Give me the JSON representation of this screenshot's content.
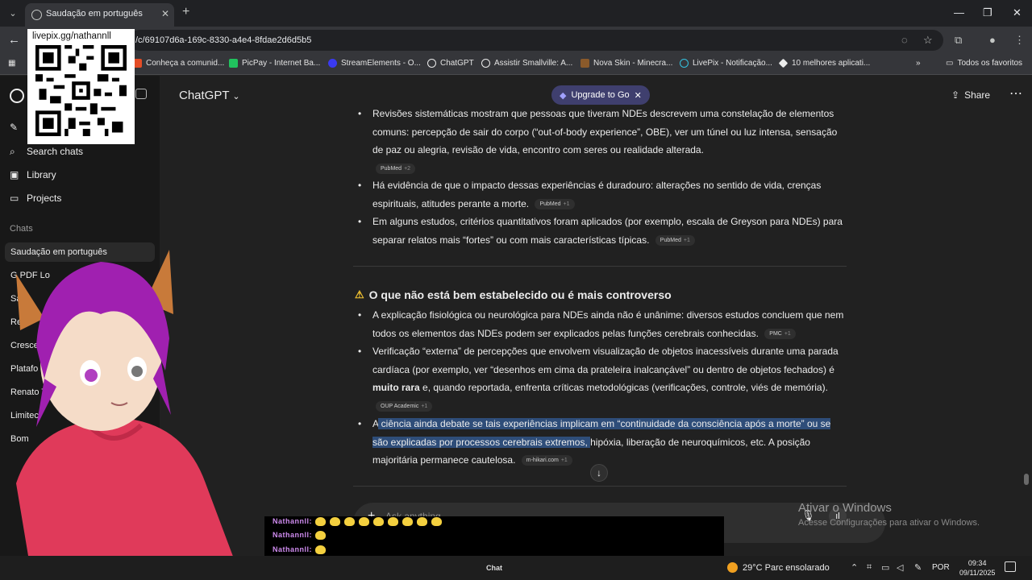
{
  "browser": {
    "tab_title": "Saudação em português",
    "url": "/c/69107d6a-169c-8330-a4e4-8fdae2d6d5b5",
    "bookmarks": [
      {
        "label": "Conheça a comunid...",
        "color": "#e44d26"
      },
      {
        "label": "PicPay - Internet Ba...",
        "color": "#21c25e"
      },
      {
        "label": "StreamElements - O...",
        "color": "#3a3af0"
      },
      {
        "label": "ChatGPT",
        "color": "#ececec"
      },
      {
        "label": "Assistir Smallville: A...",
        "color": "#ececec"
      },
      {
        "label": "Nova Skin - Minecra...",
        "color": "#8a5a2b"
      },
      {
        "label": "LivePix - Notificação...",
        "color": "#34c3e0"
      },
      {
        "label": "10 melhores aplicati...",
        "color": "#ececec"
      }
    ],
    "all_bookmarks": "Todos os favoritos"
  },
  "sidebar": {
    "search": "Search chats",
    "library": "Library",
    "projects": "Projects",
    "chats_label": "Chats",
    "chats": [
      "Saudação em português",
      "G    PDF Lo",
      "Sa",
      "Refa",
      "Cresce",
      "Platafo",
      "Renato Tr",
      "Limitec",
      "Bom"
    ]
  },
  "header": {
    "model": "ChatGPT",
    "upgrade": "Upgrade to Go",
    "share": "Share"
  },
  "content": {
    "bullet1": "Revisões sistemáticas mostram que pessoas que tiveram NDEs descrevem uma constelação de elementos comuns: percepção de sair do corpo (“out-of-body experience”, OBE), ver um túnel ou luz intensa, sensação de paz ou alegria, revisão de vida, encontro com seres ou realidade alterada.",
    "cite1": "PubMed",
    "cite1_plus": "+2",
    "bullet2": "Há evidência de que o impacto dessas experiências é duradouro: alterações no sentido de vida, crenças espirituais, atitudes perante a morte.",
    "cite2": "PubMed",
    "cite2_plus": "+1",
    "bullet3": "Em alguns estudos, critérios quantitativos foram aplicados (por exemplo, escala de Greyson para NDEs) para separar relatos mais “fortes” ou com mais características típicas.",
    "cite3": "PubMed",
    "cite3_plus": "+1",
    "heading": "O que não está bem estabelecido ou é mais controverso",
    "bullet4": "A explicação fisiológica ou neurológica para NDEs ainda não é unânime: diversos estudos concluem que nem todos os elementos das NDEs podem ser explicados pelas funções cerebrais conhecidas.",
    "cite4": "PMC",
    "cite4_plus": "+1",
    "bullet5_a": "Verificação “externa” de percepções que envolvem visualização de objetos inacessíveis durante uma parada cardíaca (por exemplo, ver “desenhos em cima da prateleira inalcançável” ou dentro de objetos fechados) é ",
    "bullet5_b": "muito rara",
    "bullet5_c": " e, quando reportada, enfrenta críticas metodológicas (verificações, controle, viés de memória).",
    "cite5": "OUP Academic",
    "cite5_plus": "+1",
    "bullet6_a": "A",
    "bullet6_hl": " ciência ainda debate se tais experiências implicam em “continuidade da consciência após a morte” ou se são explicadas por processos cerebrais extremos, ",
    "bullet6_c": "hipóxia, liberação de neuroquímicos, etc. A posição majoritária permanece cautelosa.",
    "cite6": "m-hikari.com",
    "cite6_plus": "+1"
  },
  "composer": {
    "placeholder": "Ask anything"
  },
  "overlay": {
    "qr_title": "livepix.gg/nathannll",
    "chat_user": "Nathannll:",
    "chat_footer": "Chat",
    "activate_title": "Ativar o Windows",
    "activate_sub": "Acesse Configurações para ativar o Windows."
  },
  "taskbar": {
    "weather": "29°C  Parc ensolarado",
    "lang": "POR",
    "time": "09:34",
    "date": "09/11/2025"
  }
}
